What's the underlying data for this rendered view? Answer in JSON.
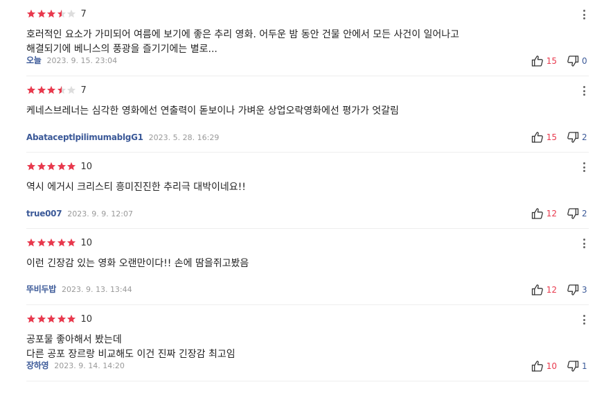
{
  "colors": {
    "star_full": "#e8394d",
    "star_empty": "#dddddd",
    "nickname": "#3b5998",
    "like_count": "#e8394d",
    "dislike_count": "#3b5998"
  },
  "reviews": [
    {
      "stars": 3.5,
      "score": "7",
      "content": "호러적인 요소가 가미되어 여름에 보기에 좋은 추리 영화. 어두운 밤 동안 건물 안에서 모든 사건이 일어나고\n해결되기에 베니스의 풍광을 즐기기에는 별로...",
      "nickname": "오늘",
      "date": "2023. 9. 15. 23:04",
      "likes": "15",
      "dislikes": "0"
    },
    {
      "stars": 3.5,
      "score": "7",
      "content": "케네스브레너는 심각한  영화에선 연출력이 돋보이나  가벼운 상업오락영화에선 평가가 엇갈림",
      "nickname": "AbataceptlpilimumablgG1",
      "date": "2023. 5. 28. 16:29",
      "likes": "15",
      "dislikes": "2"
    },
    {
      "stars": 5,
      "score": "10",
      "content": "역시 에거시 크리스티 흥미진진한 추리극 대박이네요!!",
      "nickname": "true007",
      "date": "2023. 9. 9. 12:07",
      "likes": "12",
      "dislikes": "2"
    },
    {
      "stars": 5,
      "score": "10",
      "content": "이런 긴장감 있는 영화 오랜만이다!! 손에 땀을쥐고봤음",
      "nickname": "뚜비두밥",
      "date": "2023. 9. 13. 13:44",
      "likes": "12",
      "dislikes": "3"
    },
    {
      "stars": 5,
      "score": "10",
      "content": "공포물 좋아해서 봤는데\n다른 공포 장르랑 비교해도 이건 진짜 긴장감 최고임",
      "nickname": "장하영",
      "date": "2023. 9. 14. 14:20",
      "likes": "10",
      "dislikes": "1"
    }
  ]
}
